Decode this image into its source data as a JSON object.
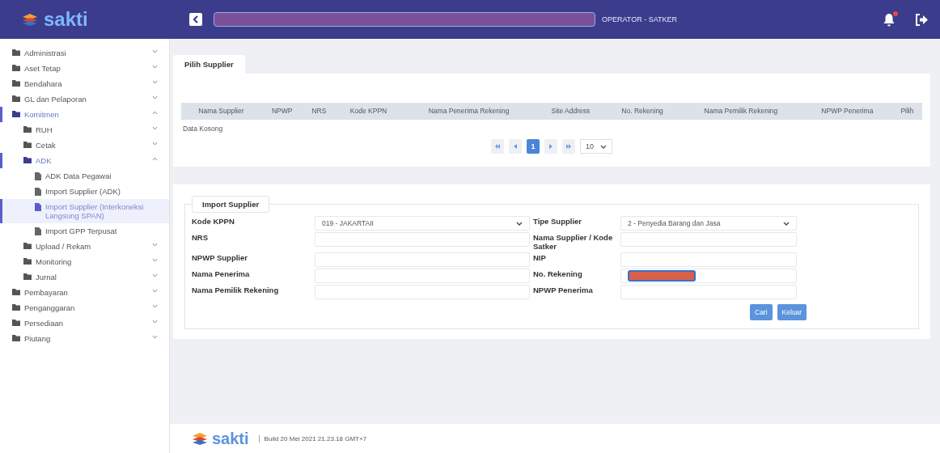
{
  "header": {
    "logo": "sakti",
    "role": "OPERATOR - SATKER"
  },
  "sidebar": {
    "items": [
      {
        "label": "Administrasi",
        "kind": "folder",
        "expanded": false,
        "selected": false
      },
      {
        "label": "Aset Tetap",
        "kind": "folder",
        "expanded": false,
        "selected": false
      },
      {
        "label": "Bendahara",
        "kind": "folder",
        "expanded": false,
        "selected": false
      },
      {
        "label": "GL dan Pelaporan",
        "kind": "folder",
        "expanded": false,
        "selected": false
      },
      {
        "label": "Komitmen",
        "kind": "folder",
        "expanded": true,
        "selected": false,
        "children": [
          {
            "label": "RUH",
            "kind": "folder",
            "expanded": false,
            "selected": false
          },
          {
            "label": "Cetak",
            "kind": "folder",
            "expanded": false,
            "selected": false
          },
          {
            "label": "ADK",
            "kind": "folder",
            "expanded": true,
            "selected": false,
            "children": [
              {
                "label": "ADK Data Pegawai",
                "kind": "file",
                "selected": false
              },
              {
                "label": "Import Supplier (ADK)",
                "kind": "file",
                "selected": false
              },
              {
                "label": "Import Supplier (Interkoneksi Langsung SPAN)",
                "kind": "file",
                "selected": true
              },
              {
                "label": "Import GPP Terpusat",
                "kind": "file",
                "selected": false
              }
            ]
          },
          {
            "label": "Upload / Rekam",
            "kind": "folder",
            "expanded": false,
            "selected": false
          },
          {
            "label": "Monitoring",
            "kind": "folder",
            "expanded": false,
            "selected": false
          },
          {
            "label": "Jurnal",
            "kind": "folder",
            "expanded": false,
            "selected": false
          }
        ]
      },
      {
        "label": "Pembayaran",
        "kind": "folder",
        "expanded": false,
        "selected": false
      },
      {
        "label": "Penganggaran",
        "kind": "folder",
        "expanded": false,
        "selected": false
      },
      {
        "label": "Persediaan",
        "kind": "folder",
        "expanded": false,
        "selected": false
      },
      {
        "label": "Piutang",
        "kind": "folder",
        "expanded": false,
        "selected": false
      }
    ]
  },
  "pilih_supplier": {
    "title": "Pilih Supplier",
    "table": {
      "columns": [
        "Nama Supplier",
        "NPWP",
        "NRS",
        "Kode KPPN",
        "Nama Penerima Rekening",
        "Site Address",
        "No. Rekening",
        "Nama Pemilik Rekening",
        "NPWP Penerima",
        "Pilih"
      ],
      "empty_text": "Data Kosong"
    },
    "pagination": {
      "pages": [
        {
          "label": "1",
          "selected": true
        }
      ],
      "page_size": "10"
    }
  },
  "import_supplier": {
    "title": "Import Supplier",
    "fields": [
      {
        "label": "Kode KPPN",
        "kind": "select",
        "value": "019 - JAKARTAII"
      },
      {
        "label": "Tipe Supplier",
        "kind": "select",
        "value": "2 - Penyedia Barang dan Jasa"
      },
      {
        "label": "NRS",
        "kind": "text"
      },
      {
        "label": "Nama Supplier / Kode Satker",
        "kind": "text"
      },
      {
        "label": "NPWP Supplier",
        "kind": "text"
      },
      {
        "label": "NIP",
        "kind": "text"
      },
      {
        "label": "Nama Penerima",
        "kind": "text"
      },
      {
        "label": "No. Rekening",
        "kind": "redacted"
      },
      {
        "label": "Nama Pemilik Rekening",
        "kind": "text"
      },
      {
        "label": "NPWP Penerima",
        "kind": "text"
      }
    ],
    "buttons": [
      "Cari",
      "Keluar"
    ]
  },
  "footer": {
    "logo": "sakti",
    "build": "Build 20 Mei 2021 21.23.18 GMT+7"
  }
}
